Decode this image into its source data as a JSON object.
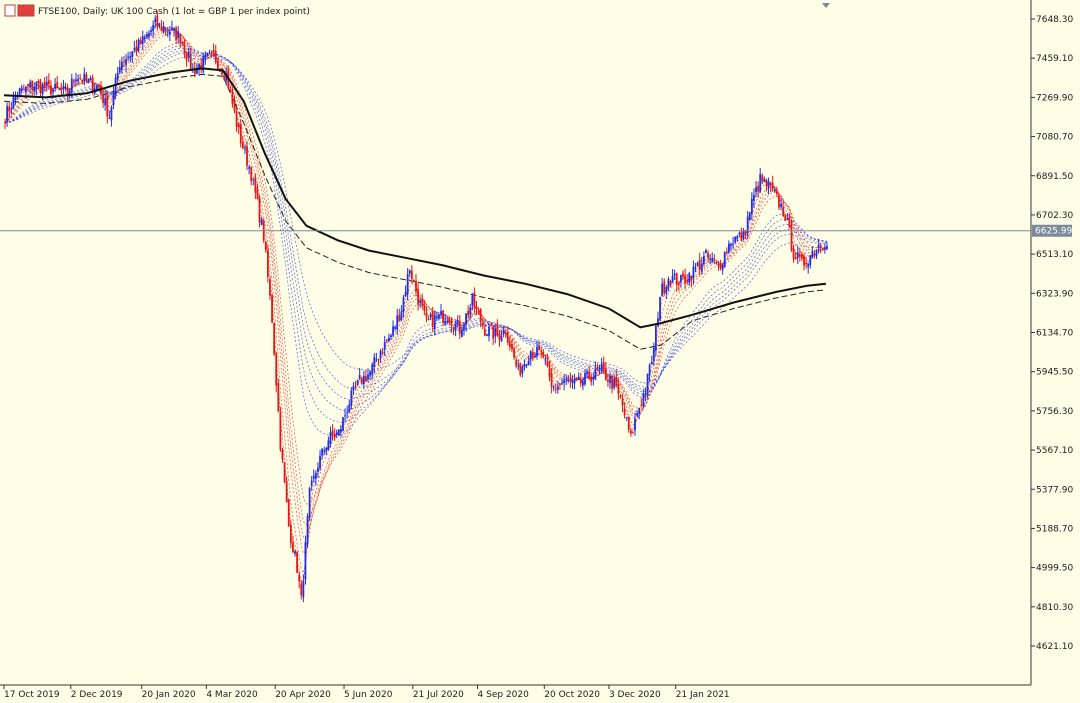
{
  "symbol_title": "FTSE100, Daily:  UK 100 Cash (1 lot = GBP 1 per index point)",
  "current_price": "6625.99",
  "colors": {
    "background": "#fefde6",
    "bull": "#1f2ee6",
    "bear": "#e41616",
    "long_ma": "#111111",
    "price_line": "#7c8a9a",
    "tag": "#7c8a9a"
  },
  "chart_data": {
    "type": "candlestick",
    "title": "FTSE100, Daily:  UK 100 Cash (1 lot = GBP 1 per index point)",
    "x_tick_labels": [
      "17 Oct 2019",
      "2 Dec 2019",
      "20 Jan 2020",
      "4 Mar 2020",
      "20 Apr 2020",
      "5 Jun 2020",
      "21 Jul 2020",
      "4 Sep 2020",
      "20 Oct 2020",
      "3 Dec 2020",
      "21 Jan 2021"
    ],
    "y_tick_labels": [
      "7648.30",
      "7459.10",
      "7269.90",
      "7080.70",
      "6891.50",
      "6702.30",
      "6513.10",
      "6323.90",
      "6134.70",
      "5945.50",
      "5756.30",
      "5567.10",
      "5377.90",
      "5188.70",
      "4999.50",
      "4810.30",
      "4621.10"
    ],
    "y_tick_values": [
      7648.3,
      7459.1,
      7269.9,
      7080.7,
      6891.5,
      6702.3,
      6513.1,
      6323.9,
      6134.7,
      5945.5,
      5756.3,
      5567.1,
      5377.9,
      5188.7,
      4999.5,
      4810.3,
      4621.1
    ],
    "ylim": [
      4490,
      7730
    ],
    "current_price_line": 6625.99,
    "price_path": [
      [
        0,
        7180
      ],
      [
        6,
        7290
      ],
      [
        14,
        7330
      ],
      [
        22,
        7310
      ],
      [
        30,
        7290
      ],
      [
        34,
        7380
      ],
      [
        40,
        7340
      ],
      [
        45,
        7320
      ],
      [
        50,
        7180
      ],
      [
        55,
        7440
      ],
      [
        60,
        7480
      ],
      [
        66,
        7540
      ],
      [
        72,
        7620
      ],
      [
        78,
        7600
      ],
      [
        84,
        7560
      ],
      [
        90,
        7400
      ],
      [
        95,
        7440
      ],
      [
        100,
        7470
      ],
      [
        106,
        7380
      ],
      [
        112,
        7100
      ],
      [
        118,
        6900
      ],
      [
        124,
        6600
      ],
      [
        128,
        6200
      ],
      [
        132,
        5600
      ],
      [
        136,
        5200
      ],
      [
        140,
        5000
      ],
      [
        142,
        4840
      ],
      [
        146,
        5350
      ],
      [
        150,
        5500
      ],
      [
        155,
        5620
      ],
      [
        160,
        5650
      ],
      [
        165,
        5800
      ],
      [
        170,
        5900
      ],
      [
        175,
        5940
      ],
      [
        180,
        6050
      ],
      [
        185,
        6120
      ],
      [
        190,
        6250
      ],
      [
        194,
        6450
      ],
      [
        198,
        6300
      ],
      [
        202,
        6180
      ],
      [
        206,
        6200
      ],
      [
        212,
        6220
      ],
      [
        218,
        6150
      ],
      [
        224,
        6280
      ],
      [
        230,
        6150
      ],
      [
        236,
        6120
      ],
      [
        240,
        6150
      ],
      [
        246,
        5940
      ],
      [
        252,
        6050
      ],
      [
        258,
        6020
      ],
      [
        262,
        5860
      ],
      [
        268,
        5900
      ],
      [
        274,
        5880
      ],
      [
        280,
        5920
      ],
      [
        286,
        5950
      ],
      [
        292,
        5880
      ],
      [
        296,
        5780
      ],
      [
        300,
        5620
      ],
      [
        303,
        5750
      ],
      [
        307,
        5860
      ],
      [
        311,
        6050
      ],
      [
        314,
        6320
      ],
      [
        318,
        6400
      ],
      [
        324,
        6380
      ],
      [
        330,
        6430
      ],
      [
        336,
        6500
      ],
      [
        342,
        6450
      ],
      [
        348,
        6580
      ],
      [
        354,
        6600
      ],
      [
        358,
        6760
      ],
      [
        362,
        6870
      ],
      [
        366,
        6840
      ],
      [
        370,
        6780
      ],
      [
        374,
        6700
      ],
      [
        378,
        6520
      ],
      [
        382,
        6460
      ],
      [
        386,
        6510
      ],
      [
        390,
        6560
      ],
      [
        394,
        6580
      ]
    ],
    "long_ma": [
      [
        0,
        7280
      ],
      [
        20,
        7270
      ],
      [
        40,
        7290
      ],
      [
        60,
        7350
      ],
      [
        80,
        7390
      ],
      [
        95,
        7410
      ],
      [
        105,
        7400
      ],
      [
        115,
        7250
      ],
      [
        125,
        7000
      ],
      [
        135,
        6780
      ],
      [
        145,
        6650
      ],
      [
        160,
        6580
      ],
      [
        175,
        6530
      ],
      [
        190,
        6500
      ],
      [
        210,
        6460
      ],
      [
        230,
        6410
      ],
      [
        250,
        6370
      ],
      [
        270,
        6320
      ],
      [
        290,
        6250
      ],
      [
        305,
        6160
      ],
      [
        315,
        6180
      ],
      [
        330,
        6220
      ],
      [
        350,
        6280
      ],
      [
        370,
        6330
      ],
      [
        385,
        6360
      ],
      [
        394,
        6370
      ]
    ],
    "series": [
      {
        "name": "",
        "type": "candlestick",
        "color_up": "#1f2ee6",
        "color_down": "#e41616"
      }
    ]
  }
}
